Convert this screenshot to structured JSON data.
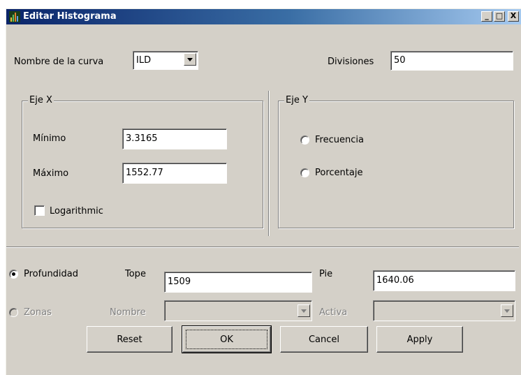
{
  "window": {
    "title": "Editar Histograma",
    "buttons": {
      "minimize": "_",
      "maximize": "□",
      "close": "X"
    }
  },
  "top": {
    "curve_label": "Nombre de la curva",
    "curve_value": "ILD",
    "divisions_label": "Divisiones",
    "divisions_value": "50"
  },
  "axis_x": {
    "title": "Eje X",
    "min_label": "Mínimo",
    "min_value": "3.3165",
    "max_label": "Máximo",
    "max_value": "1552.77",
    "log_label": "Logarithmic",
    "log_checked": false
  },
  "axis_y": {
    "title": "Eje Y",
    "freq_label": "Frecuencia",
    "percent_label": "Porcentaje",
    "selected": "none"
  },
  "depth": {
    "depth_label": "Profundidad",
    "depth_selected": true,
    "top_label": "Tope",
    "top_value": "1509",
    "bottom_label": "Pie",
    "bottom_value": "1640.06",
    "zones_label": "Zonas",
    "name_label": "Nombre",
    "active_label": "Activa"
  },
  "buttons": {
    "reset": "Reset",
    "ok": "OK",
    "cancel": "Cancel",
    "apply": "Apply"
  },
  "icons": {
    "app": "histogram-app-icon",
    "dropdown": "chevron-down-icon"
  },
  "colors": {
    "title_start": "#0a246a",
    "title_end": "#a6caf0",
    "face": "#d4d0c8"
  }
}
